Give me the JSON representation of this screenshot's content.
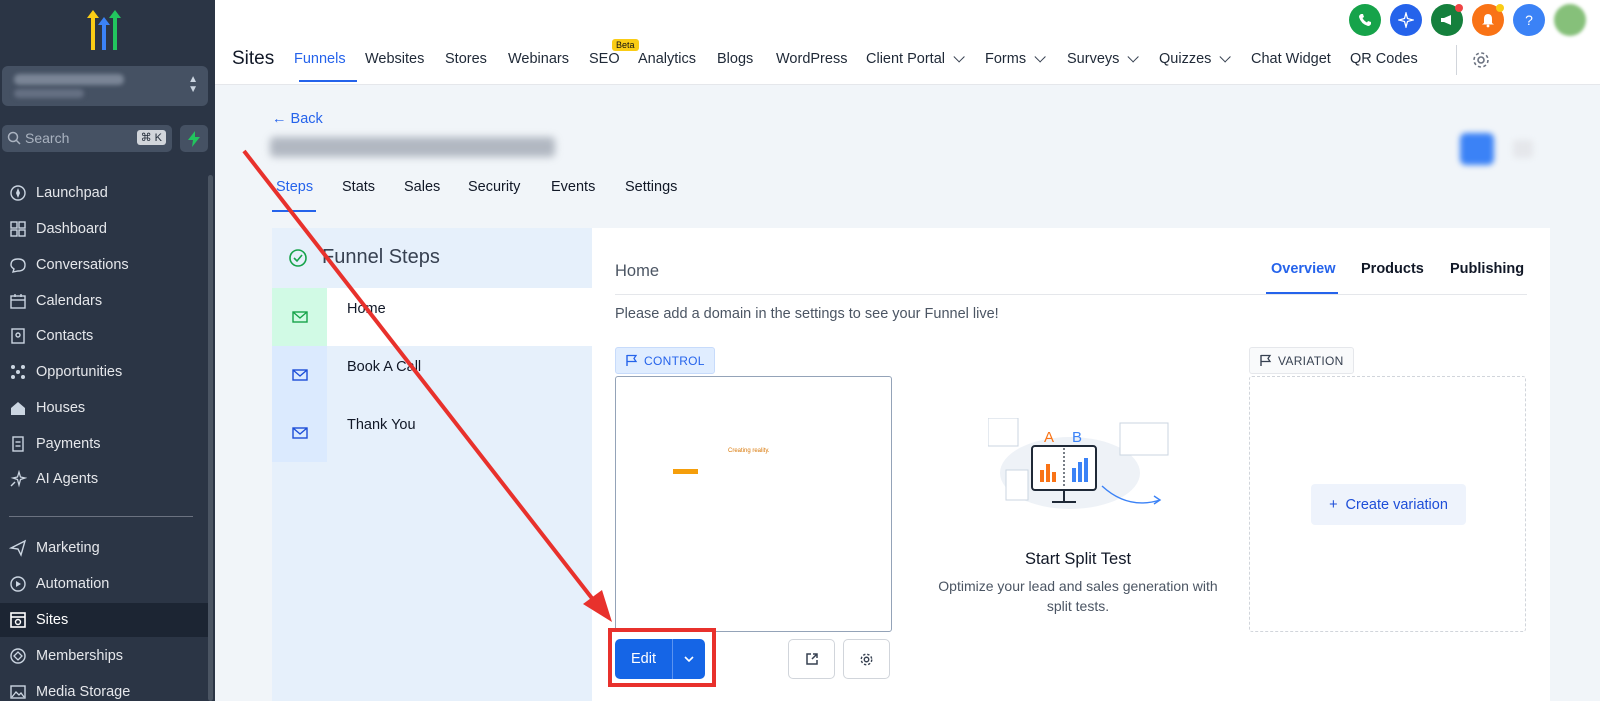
{
  "app": {
    "title": "Sites"
  },
  "sidebar": {
    "search_placeholder": "Search",
    "search_shortcut": "⌘ K",
    "items": [
      {
        "label": "Launchpad",
        "icon": "rocket-icon"
      },
      {
        "label": "Dashboard",
        "icon": "grid-icon"
      },
      {
        "label": "Conversations",
        "icon": "chat-icon"
      },
      {
        "label": "Calendars",
        "icon": "calendar-icon"
      },
      {
        "label": "Contacts",
        "icon": "contacts-icon"
      },
      {
        "label": "Opportunities",
        "icon": "network-icon"
      },
      {
        "label": "Houses",
        "icon": "house-icon"
      },
      {
        "label": "Payments",
        "icon": "receipt-icon"
      },
      {
        "label": "AI Agents",
        "icon": "sparkle-icon"
      },
      {
        "label": "Marketing",
        "icon": "send-icon"
      },
      {
        "label": "Automation",
        "icon": "automation-icon"
      },
      {
        "label": "Sites",
        "icon": "sites-icon"
      },
      {
        "label": "Memberships",
        "icon": "membership-icon"
      },
      {
        "label": "Media Storage",
        "icon": "image-icon"
      }
    ]
  },
  "topnav": {
    "tabs": [
      "Funnels",
      "Websites",
      "Stores",
      "Webinars",
      "SEO",
      "Analytics",
      "Blogs",
      "WordPress",
      "Client Portal",
      "Forms",
      "Surveys",
      "Quizzes",
      "Chat Widget",
      "QR Codes"
    ],
    "beta_label": "Beta"
  },
  "page": {
    "back_label": "Back",
    "subtabs": [
      "Steps",
      "Stats",
      "Sales",
      "Security",
      "Events",
      "Settings"
    ]
  },
  "funnel_steps": {
    "title": "Funnel Steps",
    "steps": [
      "Home",
      "Book A Call",
      "Thank You"
    ]
  },
  "detail": {
    "step_name": "Home",
    "tabs": [
      "Overview",
      "Products",
      "Publishing"
    ],
    "domain_message": "Please add a domain in the settings to see your Funnel live!",
    "control_label": "CONTROL",
    "variation_label": "VARIATION",
    "preview_text": "Creating reality.",
    "split_title": "Start Split Test",
    "split_desc": "Optimize your lead and sales generation with split tests.",
    "create_variation_label": "Create variation",
    "edit_label": "Edit",
    "illus_a": "A",
    "illus_b": "B"
  },
  "colors": {
    "accent": "#2563eb",
    "sidebar_bg": "#2b3545",
    "annotation_red": "#e8312c"
  }
}
